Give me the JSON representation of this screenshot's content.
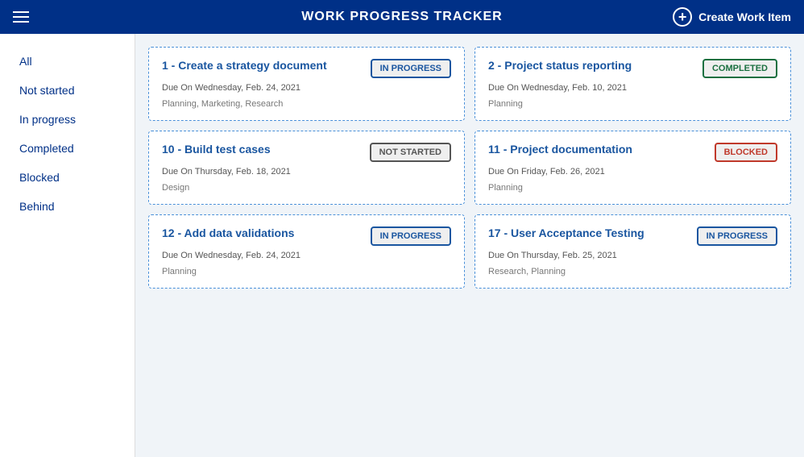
{
  "header": {
    "title": "WORK PROGRESS TRACKER",
    "create_button_label": "Create Work Item"
  },
  "sidebar": {
    "items": [
      {
        "id": "all",
        "label": "All"
      },
      {
        "id": "not-started",
        "label": "Not started"
      },
      {
        "id": "in-progress",
        "label": "In progress"
      },
      {
        "id": "completed",
        "label": "Completed"
      },
      {
        "id": "blocked",
        "label": "Blocked"
      },
      {
        "id": "behind",
        "label": "Behind"
      }
    ]
  },
  "cards": [
    {
      "id": "card-1",
      "title": "1 - Create a strategy document",
      "due": "Due On Wednesday, Feb. 24, 2021",
      "tags": "Planning, Marketing, Research",
      "status": "IN PROGRESS",
      "status_type": "in-progress"
    },
    {
      "id": "card-2",
      "title": "2 - Project status reporting",
      "due": "Due On Wednesday, Feb. 10, 2021",
      "tags": "Planning",
      "status": "COMPLETED",
      "status_type": "completed"
    },
    {
      "id": "card-10",
      "title": "10 - Build test cases",
      "due": "Due On Thursday, Feb. 18, 2021",
      "tags": "Design",
      "status": "NOT STARTED",
      "status_type": "not-started"
    },
    {
      "id": "card-11",
      "title": "11 - Project documentation",
      "due": "Due On Friday, Feb. 26, 2021",
      "tags": "Planning",
      "status": "BLOCKED",
      "status_type": "blocked"
    },
    {
      "id": "card-12",
      "title": "12 - Add data validations",
      "due": "Due On Wednesday, Feb. 24, 2021",
      "tags": "Planning",
      "status": "IN PROGRESS",
      "status_type": "in-progress"
    },
    {
      "id": "card-17",
      "title": "17 - User Acceptance Testing",
      "due": "Due On Thursday, Feb. 25, 2021",
      "tags": "Research, Planning",
      "status": "IN PROGRESS",
      "status_type": "in-progress"
    }
  ]
}
